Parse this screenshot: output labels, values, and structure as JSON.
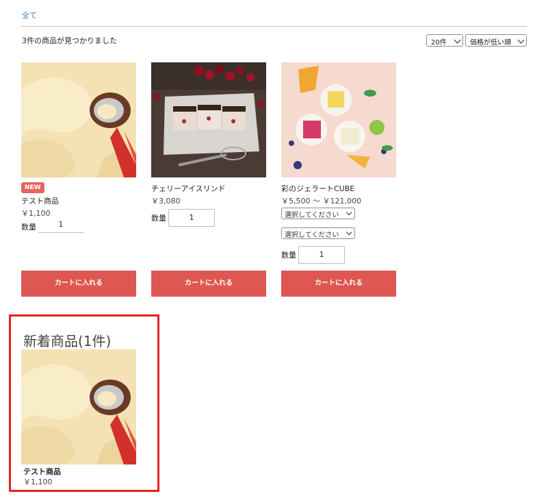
{
  "breadcrumb": {
    "all": "全て"
  },
  "results": {
    "count_text": "3件の商品が見つかりました"
  },
  "controls": {
    "per_page": "20件",
    "sort": "価格が低い順"
  },
  "products": [
    {
      "badge": "NEW",
      "name": "テスト商品",
      "price": "￥1,100",
      "qty_label": "数量",
      "qty": "1",
      "cart": "カートに入れる"
    },
    {
      "name": "チェリーアイスリンド",
      "price": "￥3,080",
      "qty_label": "数量",
      "qty": "1",
      "cart": "カートに入れる"
    },
    {
      "name": "彩のジェラートCUBE",
      "price": "￥5,500 ～ ￥121,000",
      "option1": "選択してください",
      "option2": "選択してください",
      "qty_label": "数量",
      "qty": "1",
      "cart": "カートに入れる"
    }
  ],
  "new_arrivals": {
    "title": "新着商品(1件)",
    "name": "テスト商品",
    "price": "￥1,100"
  },
  "colors": {
    "accent": "#de5752",
    "badge": "#e46562",
    "highlight": "#e8201d"
  }
}
